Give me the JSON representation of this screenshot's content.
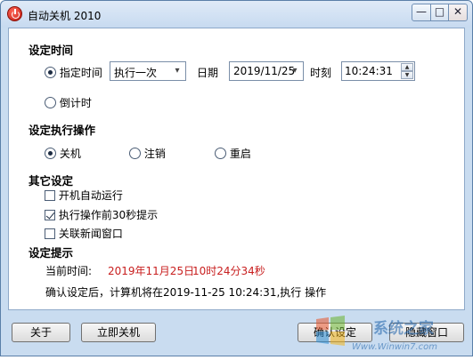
{
  "window": {
    "title": "自动关机 2010",
    "min_glyph": "—",
    "max_glyph": "□",
    "close_glyph": "✕"
  },
  "schedule": {
    "section_title": "设定时间",
    "mode_specified": "指定时间",
    "frequency": "执行一次",
    "date_label": "日期",
    "date_value": "2019/11/25",
    "time_label": "时刻",
    "time_value": "10:24:31",
    "mode_countdown": "倒计时"
  },
  "action": {
    "section_title": "设定执行操作",
    "options": [
      "关机",
      "注销",
      "重启"
    ],
    "selected": "关机"
  },
  "other": {
    "section_title": "其它设定",
    "items": [
      {
        "label": "开机自动运行",
        "checked": false
      },
      {
        "label": "执行操作前30秒提示",
        "checked": true
      },
      {
        "label": "关联新闻窗口",
        "checked": false
      }
    ]
  },
  "tips": {
    "section_title": "设定提示",
    "current_label": "当前时间:",
    "current_date": "2019年11月25日",
    "current_time": "10时24分34秒",
    "confirm_text": "确认设定后，计算机将在2019-11-25 10:24:31,执行  操作"
  },
  "buttons": {
    "about": "关于",
    "shutdown_now": "立即关机",
    "confirm": "确认设定",
    "hide": "隐藏窗口"
  },
  "watermark": {
    "text_cn": "系统之家",
    "text_en": "Www.Winwin7.com"
  },
  "colors": {
    "accent_red": "#c81e1e",
    "frame_blue": "#c9dcf0"
  },
  "icons": {
    "app": "power-icon",
    "dropdown": "chevron-down-icon",
    "spinner_up": "caret-up-icon",
    "spinner_down": "caret-down-icon"
  }
}
